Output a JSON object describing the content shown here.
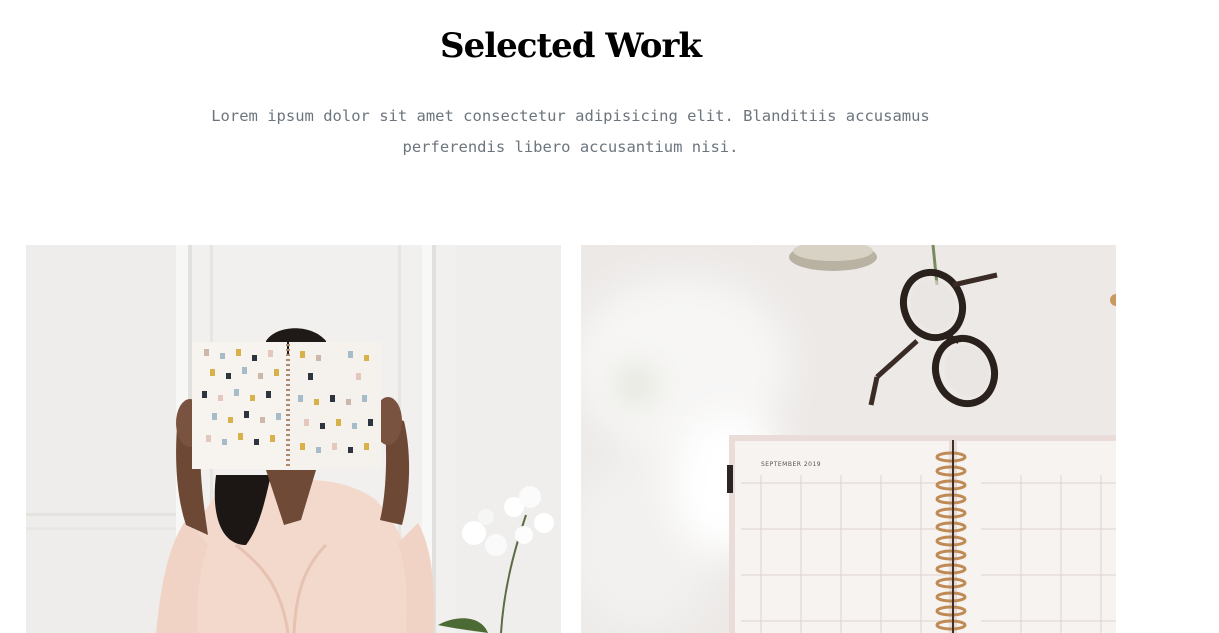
{
  "section": {
    "title": "Selected Work",
    "description": "Lorem ipsum dolor sit amet consectetur adipisicing elit. Blanditiis accusamus perferendis libero accusantium nisi."
  },
  "works": [
    {
      "image_subject": "woman holding open notebook with painted dots in front of face"
    },
    {
      "image_subject": "eyeglasses beside spiral planner open to September 2019"
    }
  ],
  "planner": {
    "month_label": "SEPTEMBER 2019"
  }
}
